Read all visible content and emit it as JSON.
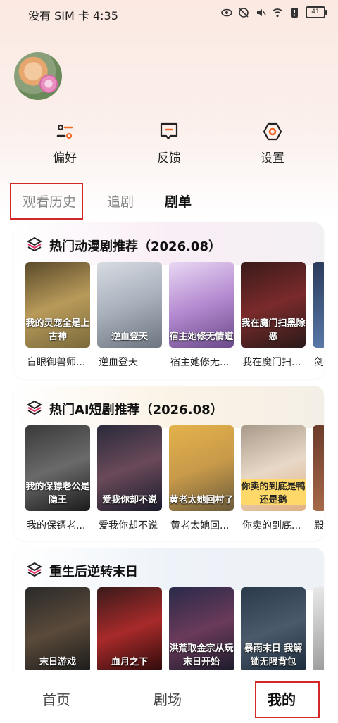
{
  "status": {
    "carrier_time": "没有 SIM 卡 4:35",
    "battery": "41"
  },
  "quick_actions": [
    {
      "label": "偏好",
      "icon": "preferences-icon"
    },
    {
      "label": "反馈",
      "icon": "feedback-icon"
    },
    {
      "label": "设置",
      "icon": "settings-icon"
    }
  ],
  "tabs": [
    {
      "label": "观看历史"
    },
    {
      "label": "追剧"
    },
    {
      "label": "剧单"
    }
  ],
  "sections": [
    {
      "title": "热门动漫剧推荐（2026.08）",
      "items": [
        {
          "title": "盲眼御兽师...",
          "poster_text": "我的灵宠全是上古神"
        },
        {
          "title": "逆血登天",
          "poster_text": "逆血登天"
        },
        {
          "title": "宿主她修无...",
          "poster_text": "宿主她修无情道"
        },
        {
          "title": "我在魔门扫...",
          "poster_text": "我在魔门扫黑除恶"
        },
        {
          "title": "剑...",
          "poster_text": ""
        }
      ]
    },
    {
      "title": "热门AI短剧推荐（2026.08）",
      "items": [
        {
          "title": "我的保镖老...",
          "poster_text": "我的保镖老公是隐王"
        },
        {
          "title": "爱我你却不说",
          "poster_text": "爱我你却不说"
        },
        {
          "title": "黄老太她回...",
          "poster_text": "黄老太她回村了"
        },
        {
          "title": "你卖的到底...",
          "poster_text": "你卖的到底是鸭还是鹅"
        },
        {
          "title": "殿...",
          "poster_text": ""
        }
      ]
    },
    {
      "title": "重生后逆转末日",
      "items": [
        {
          "title": "",
          "poster_text": "末日游戏"
        },
        {
          "title": "",
          "poster_text": "血月之下"
        },
        {
          "title": "",
          "poster_text": "洪荒取金宗从玩末日开始"
        },
        {
          "title": "",
          "poster_text": "暴雨末日 我解锁无限背包"
        },
        {
          "title": "",
          "poster_text": ""
        }
      ]
    }
  ],
  "bottom_nav": [
    {
      "label": "首页"
    },
    {
      "label": "剧场"
    },
    {
      "label": "我的"
    }
  ],
  "colors": {
    "accent_red": "#d32828",
    "header_bg": "#fbe9e2"
  }
}
